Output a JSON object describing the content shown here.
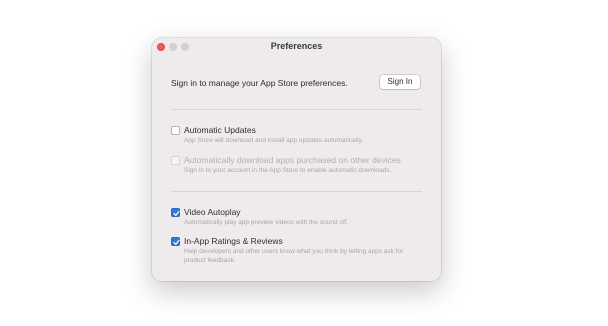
{
  "window": {
    "title": "Preferences"
  },
  "signin": {
    "message": "Sign in to manage your App Store preferences.",
    "button_label": "Sign In"
  },
  "options": [
    {
      "label": "Automatic Updates",
      "description": "App Store will download and install app updates automatically.",
      "checked": false,
      "enabled": true
    },
    {
      "label": "Automatically download apps purchased on other devices",
      "description": "Sign in to your account in the App Store to enable automatic downloads.",
      "checked": false,
      "enabled": false
    },
    {
      "label": "Video Autoplay",
      "description": "Automatically play app preview videos with the sound off.",
      "checked": true,
      "enabled": true
    },
    {
      "label": "In-App Ratings & Reviews",
      "description": "Help developers and other users know what you think by letting apps ask for product feedback.",
      "checked": true,
      "enabled": true
    }
  ],
  "colors": {
    "window_bg": "#efebec",
    "accent": "#3478d8",
    "close_button": "#ee5b55"
  }
}
